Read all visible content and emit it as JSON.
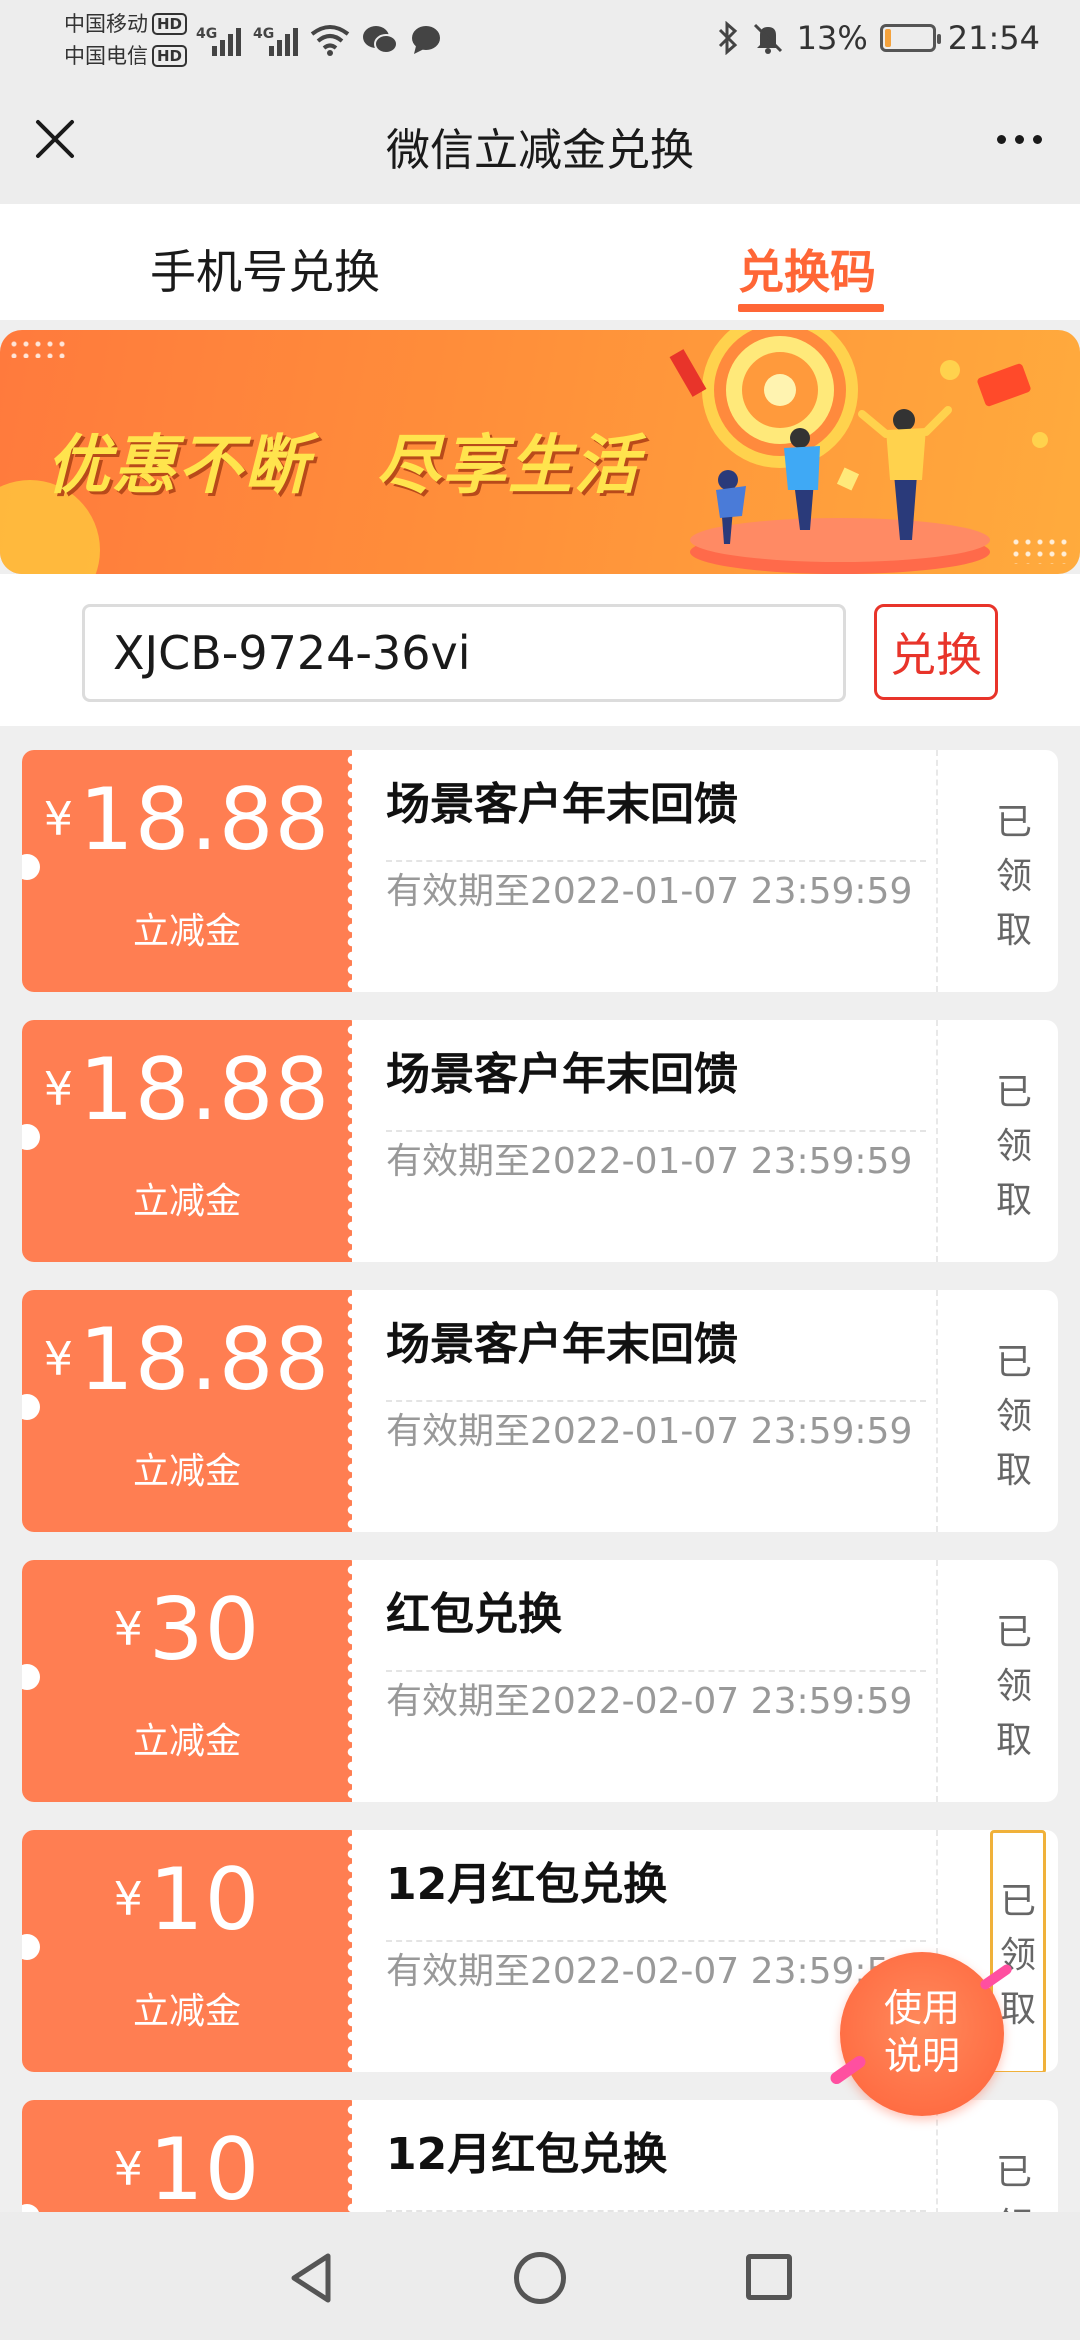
{
  "status_bar": {
    "carrier1": "中国移动",
    "carrier2": "中国电信",
    "hd_label": "HD",
    "net1": "4G",
    "net2": "4G",
    "battery": "13%",
    "time": "21:54",
    "battery_level": 0.13,
    "battery_color": "#f4a23c"
  },
  "header": {
    "title": "微信立减金兑换"
  },
  "tabs": [
    {
      "label": "手机号兑换",
      "active": false
    },
    {
      "label": "兑换码",
      "active": true
    }
  ],
  "banner": {
    "text": "优惠不断　尽享生活"
  },
  "redeem": {
    "code_value": "XJCB-9724-36vi",
    "button_label": "兑换"
  },
  "coupons": [
    {
      "currency": "¥",
      "amount": "18.88",
      "type": "立减金",
      "name": "场景客户年末回馈",
      "validity": "有效期至2022-01-07 23:59:59",
      "status": [
        "已",
        "领",
        "取"
      ]
    },
    {
      "currency": "¥",
      "amount": "18.88",
      "type": "立减金",
      "name": "场景客户年末回馈",
      "validity": "有效期至2022-01-07 23:59:59",
      "status": [
        "已",
        "领",
        "取"
      ]
    },
    {
      "currency": "¥",
      "amount": "18.88",
      "type": "立减金",
      "name": "场景客户年末回馈",
      "validity": "有效期至2022-01-07 23:59:59",
      "status": [
        "已",
        "领",
        "取"
      ]
    },
    {
      "currency": "¥",
      "amount": "30",
      "type": "立减金",
      "name": "红包兑换",
      "validity": "有效期至2022-02-07 23:59:59",
      "status": [
        "已",
        "领",
        "取"
      ]
    },
    {
      "currency": "¥",
      "amount": "10",
      "type": "立减金",
      "name": "12月红包兑换",
      "validity": "有效期至2022-02-07 23:59:59",
      "status": [
        "已",
        "领",
        "取"
      ]
    },
    {
      "currency": "¥",
      "amount": "10",
      "type": "",
      "name": "12月红包兑换",
      "validity": "",
      "status": [
        "已",
        "领"
      ]
    }
  ],
  "help_button": {
    "line1": "使用",
    "line2": "说明"
  },
  "colors": {
    "accent": "#ff6636",
    "coupon": "#ff7e52",
    "redeem_border": "#e8342a",
    "banner_text": "#ffe44d"
  }
}
